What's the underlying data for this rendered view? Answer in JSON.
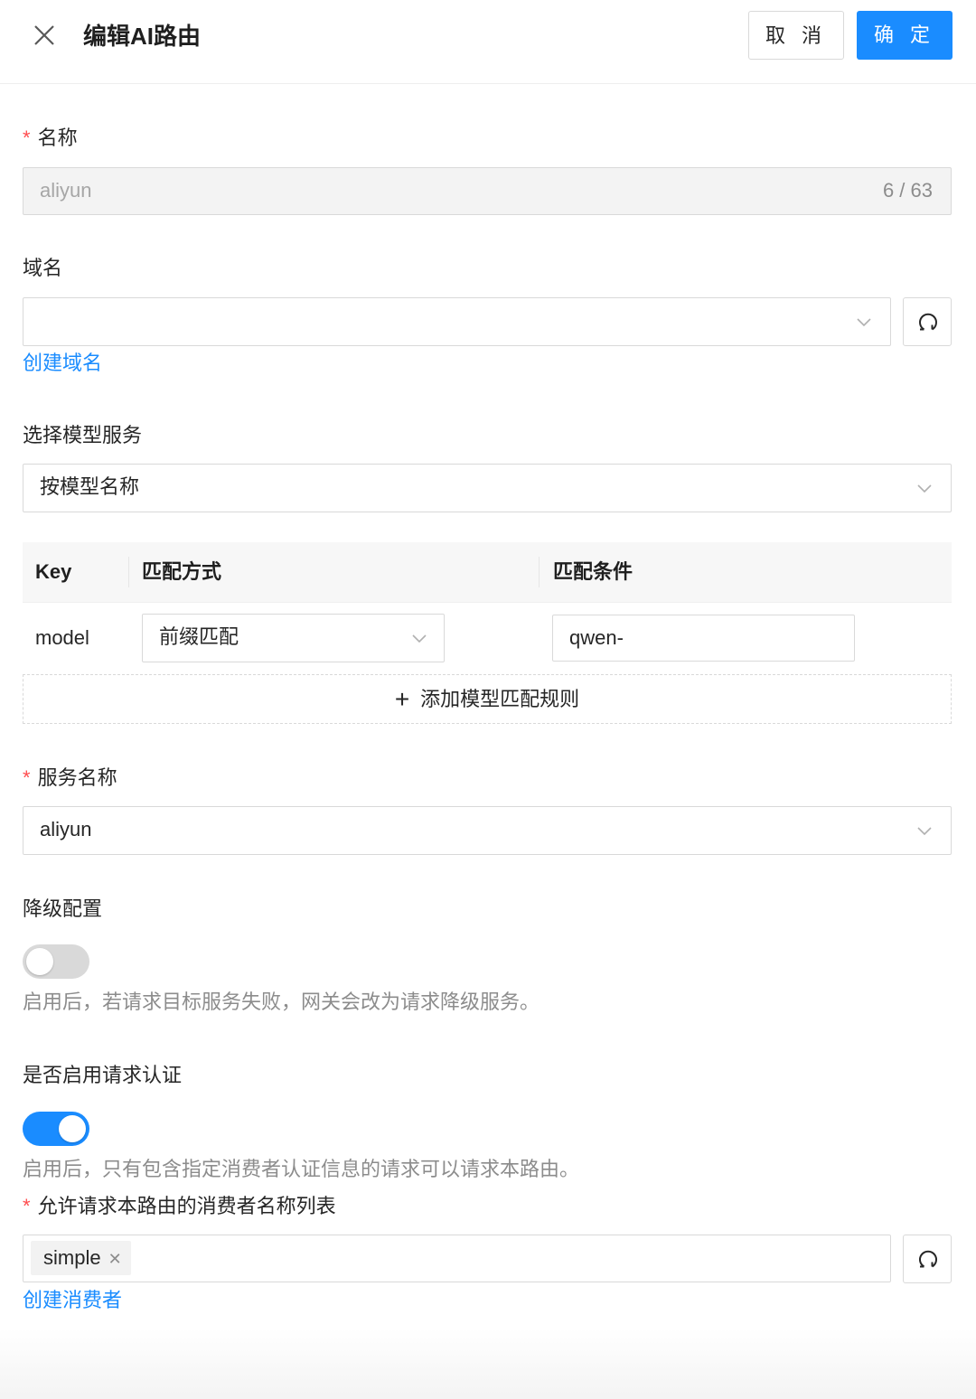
{
  "header": {
    "close_icon": "close-icon",
    "title": "编辑AI路由",
    "cancel_label": "取 消",
    "confirm_label": "确 定"
  },
  "colors": {
    "primary": "#1a8cff",
    "required": "#ff4d4f",
    "switch_off": "#d9d9d9"
  },
  "name_field": {
    "label": "名称",
    "required": true,
    "value": "aliyun",
    "counter": "6 / 63",
    "disabled": true
  },
  "domain_field": {
    "label": "域名",
    "value": "",
    "create_link": "创建域名",
    "refresh_icon": "refresh-icon"
  },
  "model_service": {
    "label": "选择模型服务",
    "value": "按模型名称",
    "table": {
      "headers": [
        "Key",
        "匹配方式",
        "匹配条件"
      ],
      "rows": [
        {
          "key": "model",
          "match_type": "前缀匹配",
          "condition": "qwen-"
        }
      ]
    },
    "add_rule_label": "添加模型匹配规则"
  },
  "service_name": {
    "label": "服务名称",
    "required": true,
    "value": "aliyun"
  },
  "fallback": {
    "label": "降级配置",
    "enabled": false,
    "hint": "启用后，若请求目标服务失败，网关会改为请求降级服务。"
  },
  "auth": {
    "label": "是否启用请求认证",
    "enabled": true,
    "hint": "启用后，只有包含指定消费者认证信息的请求可以请求本路由。"
  },
  "consumers": {
    "label": "允许请求本路由的消费者名称列表",
    "required": true,
    "tags": [
      "simple"
    ],
    "create_link": "创建消费者",
    "refresh_icon": "refresh-icon"
  }
}
